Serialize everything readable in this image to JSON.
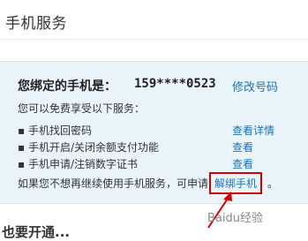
{
  "page": {
    "title": "手机服务"
  },
  "binding": {
    "label": "您绑定的手机是：",
    "number": "159****0523",
    "change_link": "修改号码",
    "intro": "您可以免费享受以下服务："
  },
  "services": [
    {
      "label": "手机找回密码",
      "link": "查看详情"
    },
    {
      "label": "手机开启/关闭余额支付功能",
      "link": "查看"
    },
    {
      "label": "手机申请/注销数字证书",
      "link": "查看"
    }
  ],
  "footer": {
    "text": "如果您不想再继续使用手机服务，可申请",
    "unbind_link": "解绑手机",
    "period": "。"
  },
  "watermark": {
    "text": "Baidu经验"
  },
  "next_section": {
    "heading": "也要开通..."
  },
  "colors": {
    "link": "#1a73b8",
    "highlight": "#d40000",
    "panel_bg": "#eaf4fb"
  }
}
